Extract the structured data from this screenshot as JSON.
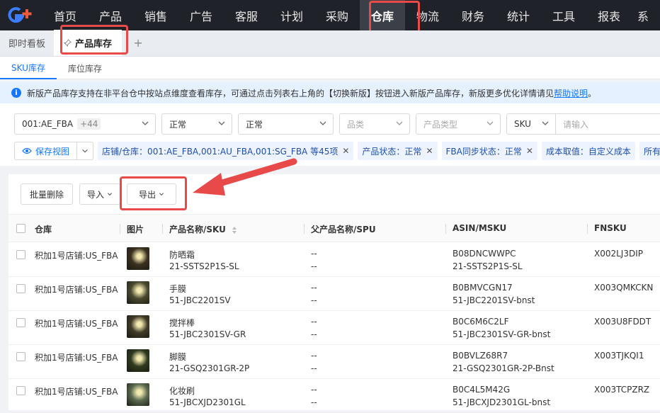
{
  "nav": {
    "logo": "G+",
    "items": [
      "首页",
      "产品",
      "销售",
      "广告",
      "客服",
      "计划",
      "采购",
      "仓库",
      "物流",
      "财务",
      "统计",
      "工具",
      "报表"
    ],
    "active": "仓库",
    "overflow": "系"
  },
  "tabs": {
    "dashboard": "即时看板",
    "active": "产品库存",
    "add": "+"
  },
  "subtabs": {
    "sku": "SKU库存",
    "location": "库位库存"
  },
  "notice": {
    "text": "新版产品库存支持在非平台仓中按站点维度查看库存，可通过点击列表右上角的【切换新版】按钮进入新版产品库存，新版更多优化详情请见",
    "link": "帮助说明",
    "end": "。"
  },
  "filters": {
    "warehouse": "001:AE_FBA",
    "warehouse_more": "+44",
    "status1": "正常",
    "status2": "正常",
    "category_ph": "品类",
    "product_type_ph": "产品类型",
    "search_field": "SKU",
    "search_ph": "请输入"
  },
  "chips": {
    "save_view": "保存视图",
    "items": [
      "店铺/仓库：001:AE_FBA,001:AU_FBA,001:SG_FBA 等45项",
      "产品状态：正常",
      "FBA同步状态：正常",
      "成本取值：自定义成本",
      "所有人：A"
    ]
  },
  "toolbar": {
    "batch_delete": "批量删除",
    "import": "导入",
    "export": "导出"
  },
  "table": {
    "headers": {
      "warehouse": "仓库",
      "image": "图片",
      "product": "产品名称/SKU",
      "parent": "父产品名称/SPU",
      "asin": "ASIN/MSKU",
      "fnsku": "FNSKU"
    },
    "rows": [
      {
        "warehouse": "积加1号店铺:US_FBA",
        "name": "防晒霜",
        "sku": "21-SSTS2P1S-SL",
        "parent1": "--",
        "parent2": "--",
        "asin": "B08DNCWWPC",
        "msku": "21-SSTS2P1S-SL",
        "fnsku": "X002LJ3DIP",
        "thumb": "#3a3020"
      },
      {
        "warehouse": "积加1号店铺:US_FBA",
        "name": "手膜",
        "sku": "51-JBC2201SV",
        "parent1": "--",
        "parent2": "--",
        "asin": "B0BMVCGN17",
        "msku": "51-JBC2201SV-bnst",
        "fnsku": "X003QMKCKN",
        "thumb": "#4a4a30"
      },
      {
        "warehouse": "积加1号店铺:US_FBA",
        "name": "搅拌棒",
        "sku": "51-JBC2301SV-GR",
        "parent1": "--",
        "parent2": "--",
        "asin": "B0C6M6C2LF",
        "msku": "51-JBC2301SV-GR-bnst",
        "fnsku": "X003U8FDDT",
        "thumb": "#403a28"
      },
      {
        "warehouse": "积加1号店铺:US_FBA",
        "name": "脚膜",
        "sku": "21-GSQ2301GR-2P",
        "parent1": "--",
        "parent2": "--",
        "asin": "B0BVLZ68R7",
        "msku": "21-GSQ2301GR-2P-Bnst",
        "fnsku": "X003TJKQI1",
        "thumb": "#2e3a1e"
      },
      {
        "warehouse": "积加1号店铺:US_FBA",
        "name": "化妆刷",
        "sku": "51-JBCXJD2301GL",
        "parent1": "--",
        "parent2": "--",
        "asin": "B0C4L5M42G",
        "msku": "51-JBCXJD2301GL-bnst",
        "fnsku": "X003TCPZRZ",
        "thumb": "#5a6a50"
      }
    ]
  },
  "colors": {
    "accent": "#1677ff",
    "highlight": "#e84a4a",
    "nav_bg": "#1f2228"
  }
}
